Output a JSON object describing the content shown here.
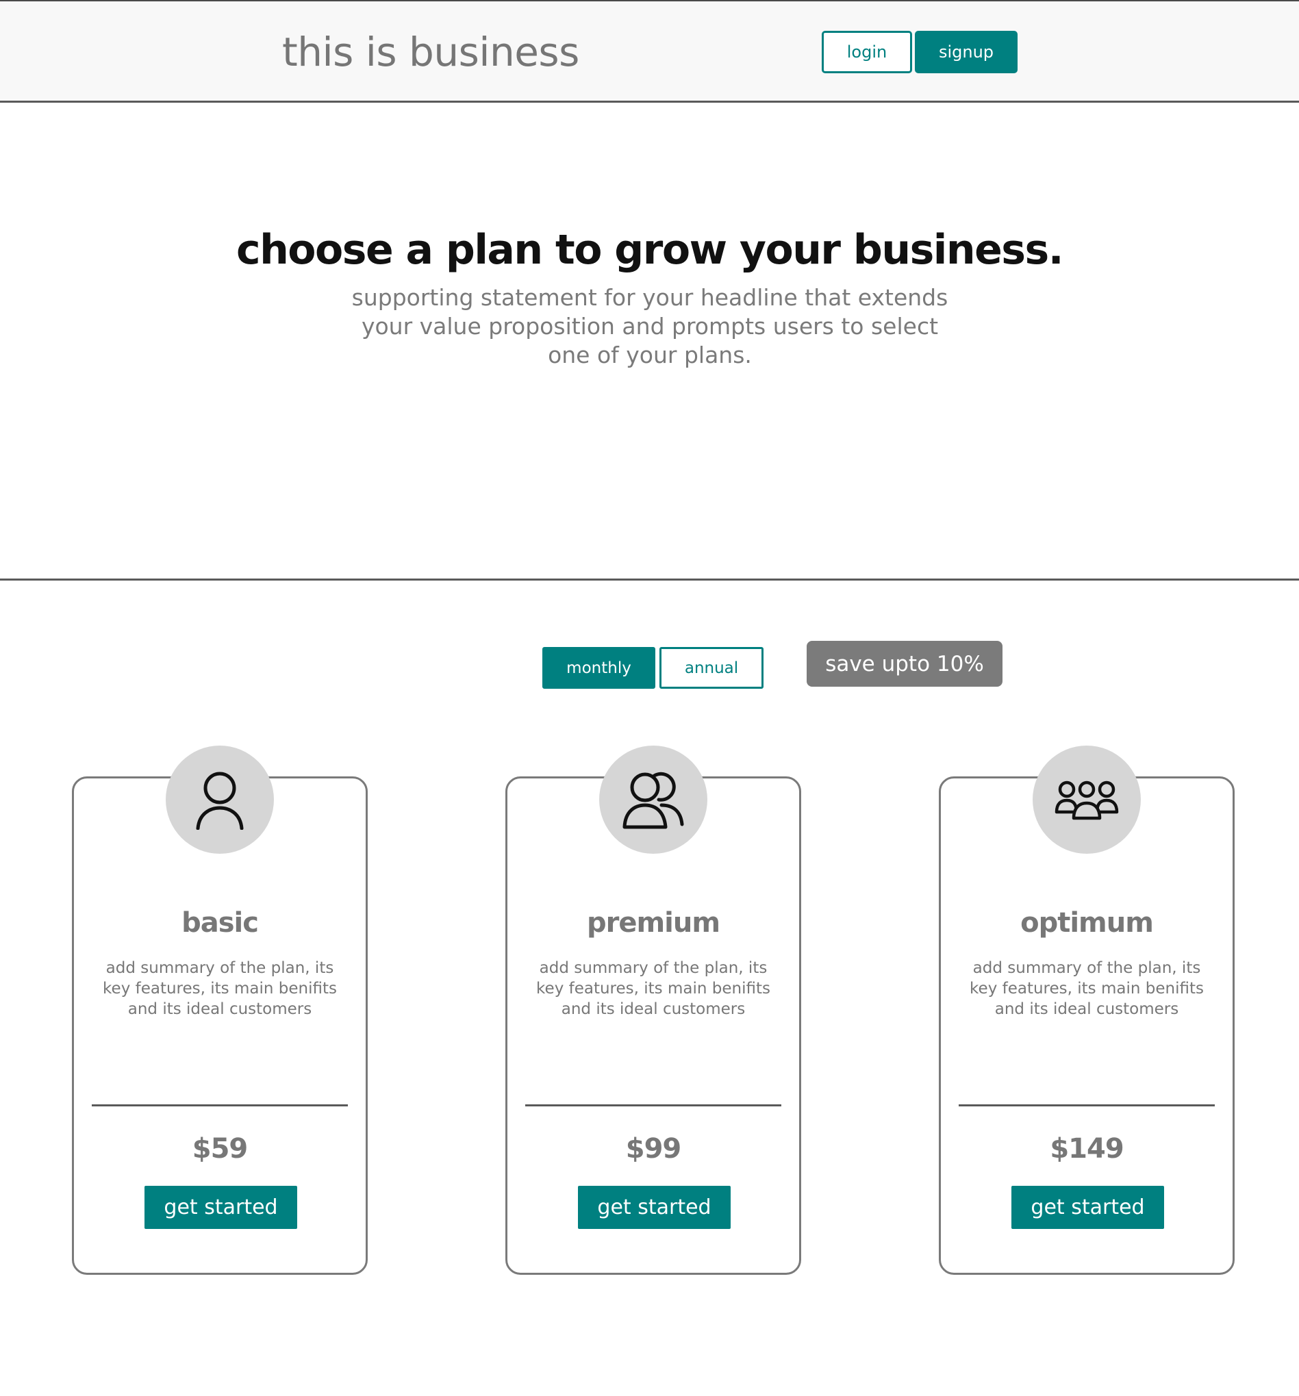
{
  "header": {
    "brand": "this is business",
    "login_label": "login",
    "signup_label": "signup"
  },
  "hero": {
    "title": "choose a plan to grow your business.",
    "subtitle": "supporting statement for your headline that extends your value proposition and prompts users to select one of your plans."
  },
  "billing": {
    "monthly_label": "monthly",
    "annual_label": "annual",
    "selected": "monthly",
    "save_badge": "save upto 10%"
  },
  "plans": [
    {
      "icon": "user-icon",
      "name": "basic",
      "summary": "add summary of the plan, its key features, its main benifits and its ideal customers",
      "price": "$59",
      "cta": "get started"
    },
    {
      "icon": "users-pair-icon",
      "name": "premium",
      "summary": "add summary of the plan, its key features, its main benifits and its ideal customers",
      "price": "$99",
      "cta": "get started"
    },
    {
      "icon": "group-icon",
      "name": "optimum",
      "summary": "add summary of the plan, its key features, its main benifits and its ideal customers",
      "price": "$149",
      "cta": "get started"
    }
  ],
  "colors": {
    "accent": "#008080",
    "badge": "#7b7b7b",
    "header_bg": "#f8f8f8",
    "icon_circle": "#d6d6d6"
  }
}
